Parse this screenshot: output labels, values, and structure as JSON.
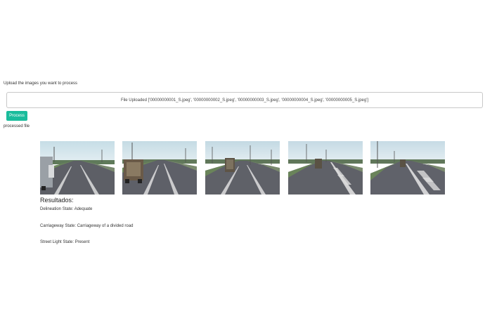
{
  "upload": {
    "label": "Upload the images you want to process",
    "file_status": "File Uploaded ['00000000001_S.jpeg', '00000000002_S.jpeg', '00000000003_S.jpeg', '00000000004_S.jpeg', '00000000005_S.jpeg']"
  },
  "process_button": {
    "label": "Process",
    "color": "#1abc9c"
  },
  "processed_label": "processed file",
  "images": [
    {
      "id": "image-1",
      "vehicle": "truck-left-near"
    },
    {
      "id": "image-2",
      "vehicle": "truck-left-mid"
    },
    {
      "id": "image-3",
      "vehicle": "truck-center"
    },
    {
      "id": "image-4",
      "vehicle": "truck-center-far"
    },
    {
      "id": "image-5",
      "vehicle": "truck-right-far"
    }
  ],
  "results": {
    "title": "Resultados:",
    "delineation": "Delineation State: Adequate",
    "carriageway": "Carriageway State: Carriageway of a divided road",
    "street_light": "Street Light State: Present"
  }
}
